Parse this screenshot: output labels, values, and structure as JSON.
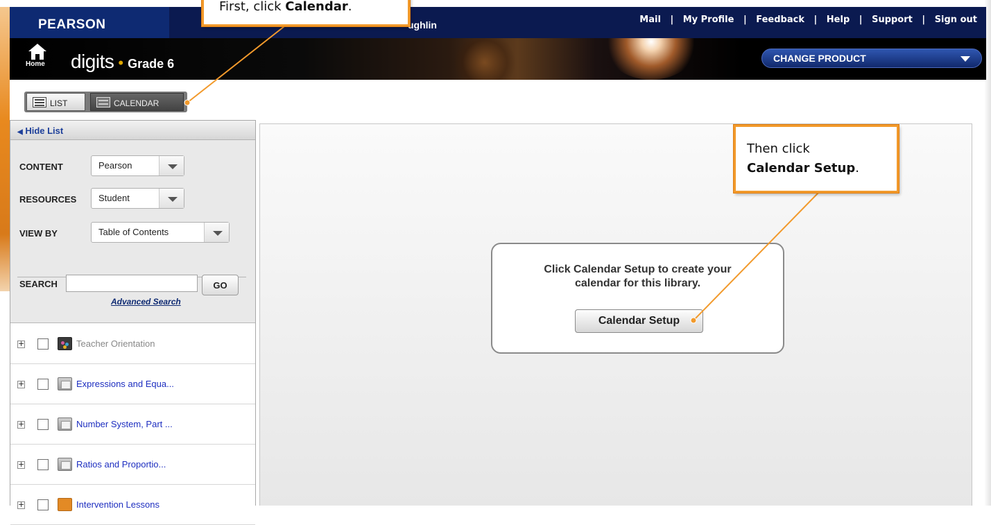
{
  "top_bar": {
    "brand": "PEARSON",
    "user_name_fragment": "ughlin",
    "links": [
      "Mail",
      "My Profile",
      "Feedback",
      "Help",
      "Support",
      "Sign out"
    ]
  },
  "header": {
    "home_label": "Home",
    "product_name": "digits",
    "separator": "•",
    "grade": "Grade 6",
    "change_product": "CHANGE PRODUCT"
  },
  "view_toggle": {
    "list": "LIST",
    "calendar": "CALENDAR"
  },
  "left_panel": {
    "hide_list": "Hide List",
    "filters": {
      "content_label": "CONTENT",
      "content_value": "Pearson",
      "resources_label": "RESOURCES",
      "resources_value": "Student",
      "view_by_label": "VIEW BY",
      "view_by_value": "Table of Contents",
      "search_label": "SEARCH",
      "search_value": "",
      "go_label": "GO",
      "advanced_search": "Advanced Search"
    },
    "tree": [
      {
        "label": "Teacher Orientation",
        "icon": "folder-dark"
      },
      {
        "label": "Expressions and Equa...",
        "icon": "book"
      },
      {
        "label": "Number System, Part ...",
        "icon": "book"
      },
      {
        "label": "Ratios and Proportio...",
        "icon": "book"
      },
      {
        "label": "Intervention Lessons",
        "icon": "folder-orange"
      }
    ]
  },
  "main": {
    "message_line1": "Click Calendar Setup to create your",
    "message_line2": "calendar for this library.",
    "setup_button": "Calendar Setup"
  },
  "callouts": {
    "first_prefix": "First, click ",
    "first_bold": "Calendar",
    "first_suffix": ".",
    "second_line1": "Then click",
    "second_bold": "Calendar Setup",
    "second_suffix": ".",
    "accent_color": "#f29a2c"
  }
}
